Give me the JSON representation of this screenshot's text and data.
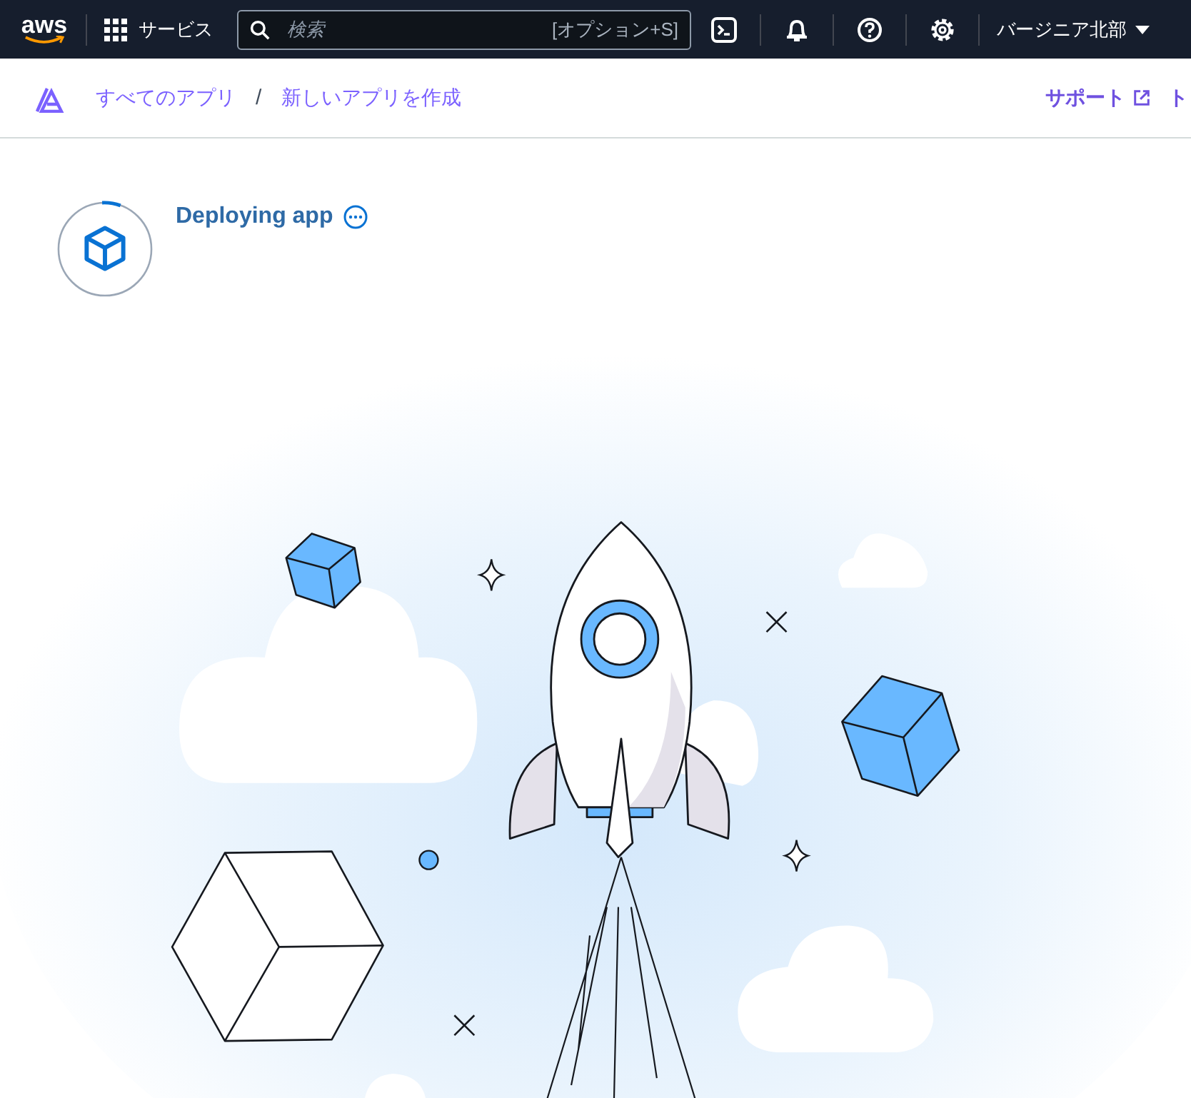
{
  "top_nav": {
    "logo": "aws",
    "services": "サービス",
    "search": {
      "placeholder": "検索",
      "shortcut": "[オプション+S]"
    },
    "region": "バージニア北部"
  },
  "breadcrumbs": [
    {
      "label": "すべてのアプリ"
    },
    {
      "label": "新しいアプリを作成"
    }
  ],
  "breadcrumb_separator": "/",
  "header_links": [
    {
      "label": "サポート",
      "external": true
    },
    {
      "label": "ト",
      "external": false
    }
  ],
  "status": {
    "title": "Deploying app"
  }
}
